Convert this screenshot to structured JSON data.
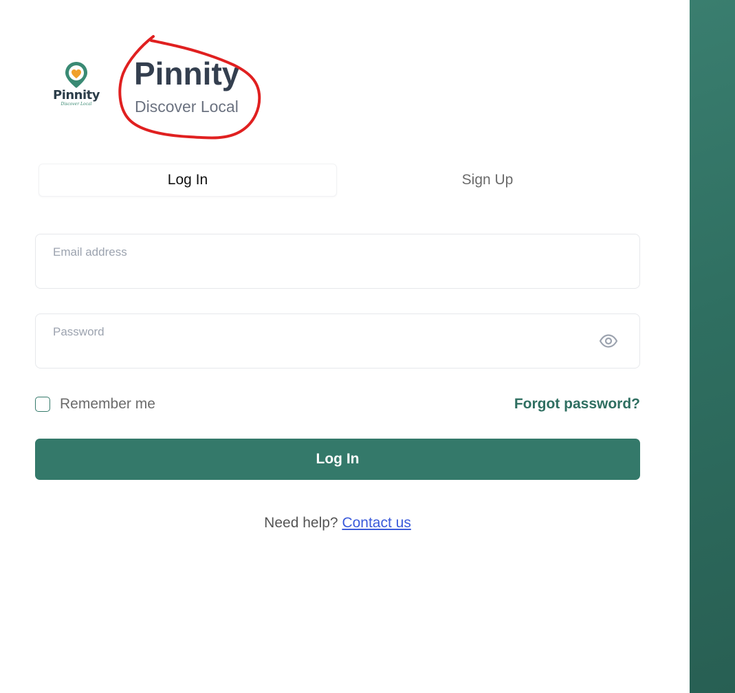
{
  "brand": {
    "logo_name": "Pinnity",
    "logo_tagline": "Discover Local",
    "title": "Pinnity",
    "subtitle": "Discover Local",
    "logo_icon": "map-pin-heart-icon"
  },
  "tabs": [
    {
      "label": "Log In",
      "active": true
    },
    {
      "label": "Sign Up",
      "active": false
    }
  ],
  "form": {
    "email": {
      "label": "Email address",
      "value": ""
    },
    "password": {
      "label": "Password",
      "value": "",
      "toggle_icon": "eye-icon"
    },
    "remember_label": "Remember me",
    "remember_checked": false,
    "forgot_label": "Forgot password?",
    "submit_label": "Log In"
  },
  "help": {
    "text": "Need help?",
    "link_label": "Contact us"
  },
  "colors": {
    "accent": "#34796a",
    "side_panel": "#2f6f61",
    "annotation": "#e02020",
    "pin_orange": "#f0a02a"
  }
}
